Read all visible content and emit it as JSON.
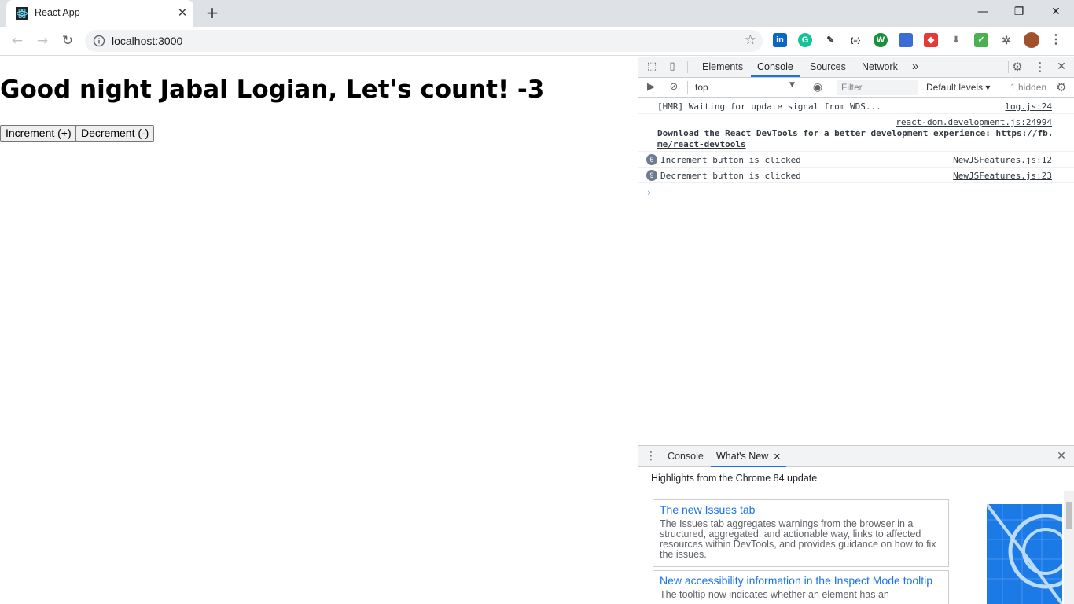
{
  "browser": {
    "tab_title": "React App",
    "new_tab": "+",
    "url": "localhost:3000",
    "window_controls": {
      "minimize": "—",
      "restore": "❐",
      "close": "✕"
    }
  },
  "page": {
    "heading": "Good night Jabal Logian, Let's count! -3",
    "increment_label": "Increment (+)",
    "decrement_label": "Decrement (-)"
  },
  "devtools": {
    "tabs": [
      "Elements",
      "Console",
      "Sources",
      "Network"
    ],
    "more_tabs": "»",
    "context": "top",
    "filter_placeholder": "Filter",
    "levels": "Default levels ▾",
    "hidden_count": "1 hidden",
    "messages": [
      {
        "text": "[HMR] Waiting for update signal from WDS...",
        "source": "log.js:24"
      },
      {
        "source": "react-dom.development.js:24994",
        "text_line1": "Download the React DevTools for a better development experience: https://fb.",
        "text_line2": "me/react-devtools"
      },
      {
        "count": "6",
        "text": "Increment button is clicked",
        "source": "NewJSFeatures.js:12"
      },
      {
        "count": "9",
        "text": "Decrement button is clicked",
        "source": "NewJSFeatures.js:23"
      }
    ],
    "prompt": "›",
    "drawer": {
      "tabs": [
        "Console",
        "What's New"
      ],
      "close_tab": "✕",
      "highlights": "Highlights from the Chrome 84 update",
      "cards": [
        {
          "title": "The new Issues tab",
          "desc": "The Issues tab aggregates warnings from the browser in a structured, aggregated, and actionable way, links to affected resources within DevTools, and provides guidance on how to fix the issues."
        },
        {
          "title": "New accessibility information in the Inspect Mode tooltip",
          "desc": "The tooltip now indicates whether an element has an"
        }
      ]
    }
  },
  "colors": {
    "accent": "#1a73e8",
    "chrome_bg": "#dee1e6",
    "panel_bg": "#f1f3f4"
  }
}
